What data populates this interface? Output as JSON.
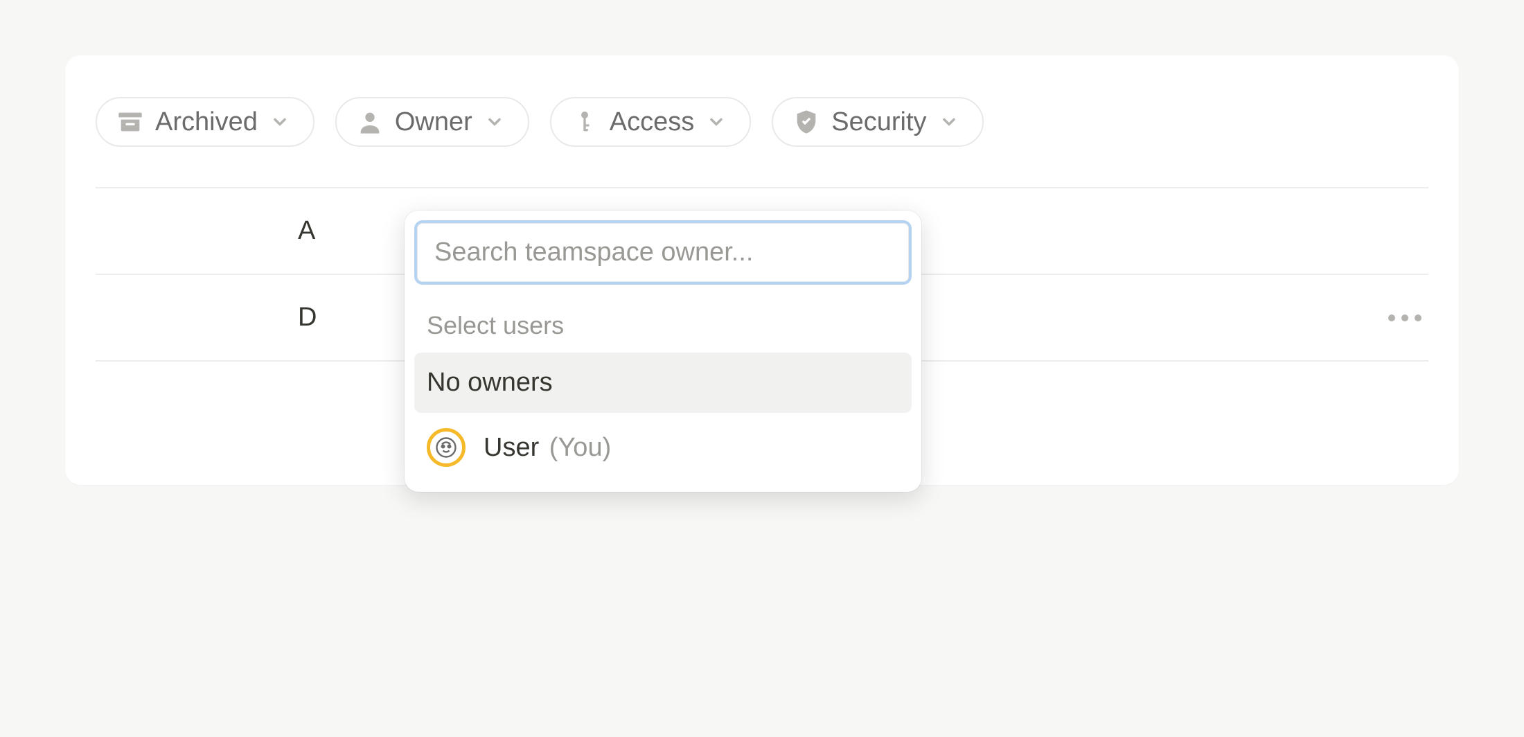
{
  "filters": {
    "archived": {
      "label": "Archived"
    },
    "owner": {
      "label": "Owner"
    },
    "access": {
      "label": "Access"
    },
    "security": {
      "label": "Security"
    }
  },
  "list": {
    "row1_prefix": "A",
    "row2_prefix": "D"
  },
  "dropdown": {
    "search_placeholder": "Search teamspace owner...",
    "section_label": "Select users",
    "options": {
      "no_owners": {
        "label": "No owners"
      },
      "current_user": {
        "name": "User",
        "suffix": "(You)"
      }
    }
  }
}
